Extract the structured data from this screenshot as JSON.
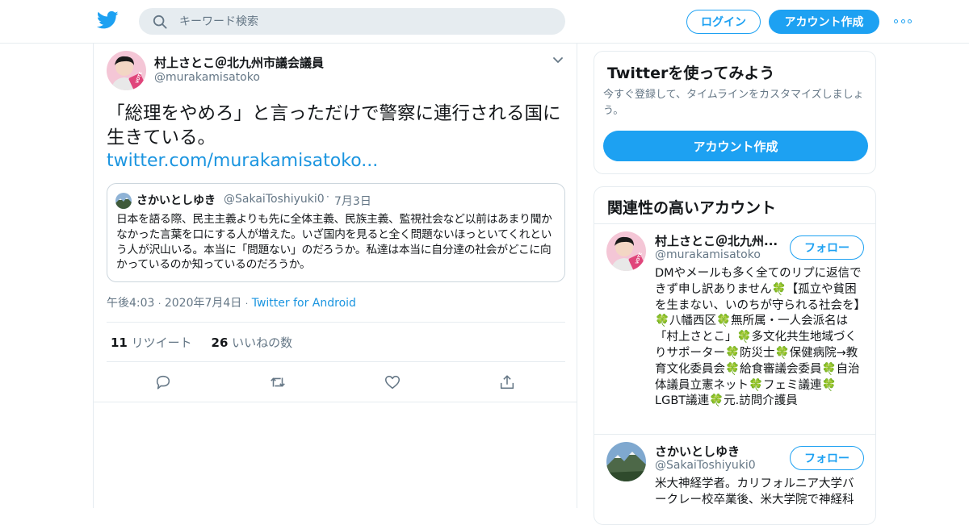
{
  "topbar": {
    "search_placeholder": "キーワード検索",
    "login_label": "ログイン",
    "signup_label": "アカウント作成"
  },
  "tweet": {
    "author_name": "村上さとこ＠北九州市議会議員",
    "author_handle": "@murakamisatoko",
    "avatar_badge": "VOTE",
    "text": "「総理をやめろ」と言っただけで警察に連行される国に生きている。",
    "link": "twitter.com/murakamisatoko...",
    "quote": {
      "name": "さかいとしゆき",
      "handle": "@SakaiToshiyuki0",
      "sep": "·",
      "date": "7月3日",
      "text": "日本を語る際、民主主義よりも先に全体主義、民族主義、監視社会など以前はあまり聞かなかった言葉を口にする人が増えた。いざ国内を見ると全く問題ないほっといてくれという人が沢山いる。本当に「問題ない」のだろうか。私達は本当に自分達の社会がどこに向かっているのか知っているのだろうか。"
    },
    "time": "午後4:03",
    "date": "2020年7月4日",
    "via": "Twitter for Android",
    "dot": "·",
    "retweets_count": "11",
    "retweets_label": "リツイート",
    "likes_count": "26",
    "likes_label": "いいねの数"
  },
  "sidebar": {
    "try_title": "Twitterを使ってみよう",
    "try_desc": "今すぐ登録して、タイムラインをカスタマイズしましょう。",
    "try_button": "アカウント作成",
    "related_title": "関連性の高いアカウント",
    "follow_label": "フォロー",
    "accounts": [
      {
        "name": "村上さとこ＠北九州...",
        "handle": "@murakamisatoko",
        "bio": "DMやメールも多く全てのリプに返信できず申し訳ありません🍀【孤立や貧困を生まない、いのちが守られる社会を】🍀八幡西区🍀無所属・一人会派名は「村上さとこ」🍀多文化共生地域づくりサポーター🍀防災士🍀保健病院→教育文化委員会🍀給食審議会委員🍀自治体議員立憲ネット🍀フェミ議連🍀LGBT議連🍀元.訪問介護員"
      },
      {
        "name": "さかいとしゆき",
        "handle": "@SakaiToshiyuki0",
        "bio": "米大神経学者。カリフォルニア大学バークレー校卒業後、米大学院で神経科"
      }
    ]
  },
  "colors": {
    "accent": "#1da1f2",
    "link": "#1b95e0",
    "muted": "#657786",
    "border": "#e6ecf0"
  }
}
